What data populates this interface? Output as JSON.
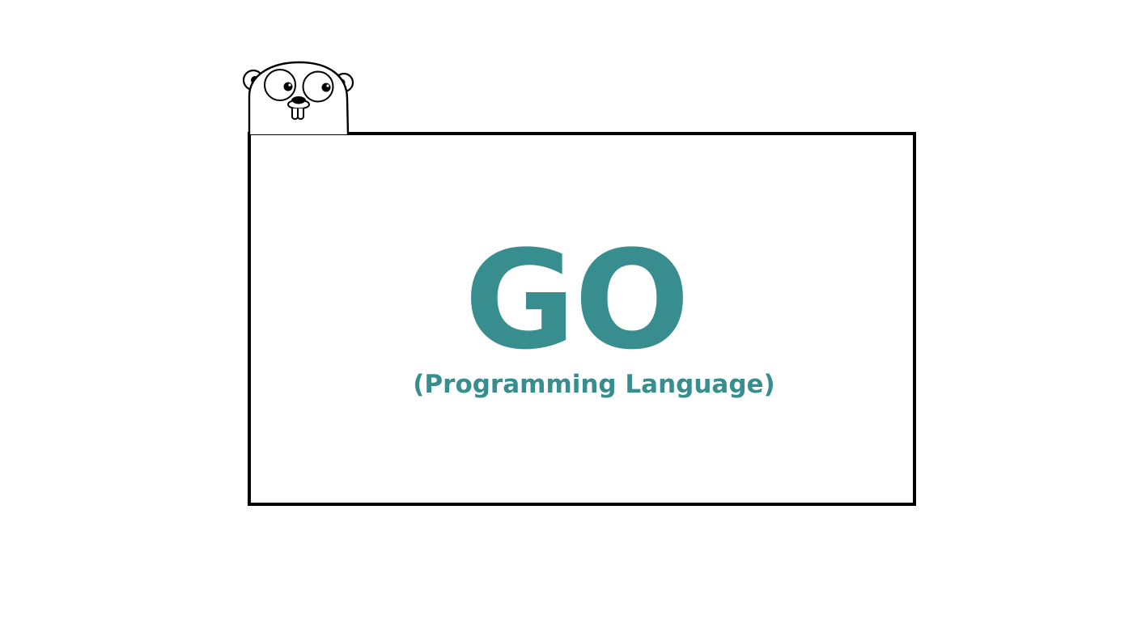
{
  "title": "GO",
  "subtitle": "(Programming Language)",
  "colors": {
    "text": "#388e8e",
    "frame_border": "#000000",
    "background": "#ffffff"
  },
  "mascot": "gopher-icon"
}
